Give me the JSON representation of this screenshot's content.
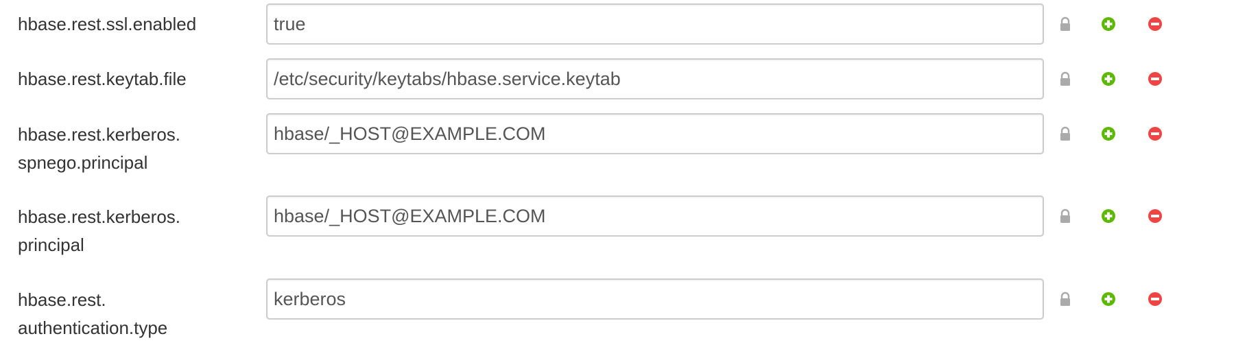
{
  "colors": {
    "add": "#5cb800",
    "remove": "#ee4444",
    "lock": "#aaaaaa",
    "input_border": "#cccccc",
    "text": "#333333"
  },
  "icons": {
    "lock": "lock-icon",
    "add": "plus-circle-icon",
    "remove": "minus-circle-icon"
  },
  "properties": [
    {
      "name_lines": [
        "hbase.rest.ssl.enabled"
      ],
      "value": "true"
    },
    {
      "name_lines": [
        "hbase.rest.keytab.file"
      ],
      "value": "/etc/security/keytabs/hbase.service.keytab"
    },
    {
      "name_lines": [
        "hbase.rest.kerberos.",
        "spnego.principal"
      ],
      "value": "hbase/_HOST@EXAMPLE.COM"
    },
    {
      "name_lines": [
        "hbase.rest.kerberos.",
        "principal"
      ],
      "value": "hbase/_HOST@EXAMPLE.COM"
    },
    {
      "name_lines": [
        "hbase.rest.",
        "authentication.type"
      ],
      "value": "kerberos"
    }
  ]
}
